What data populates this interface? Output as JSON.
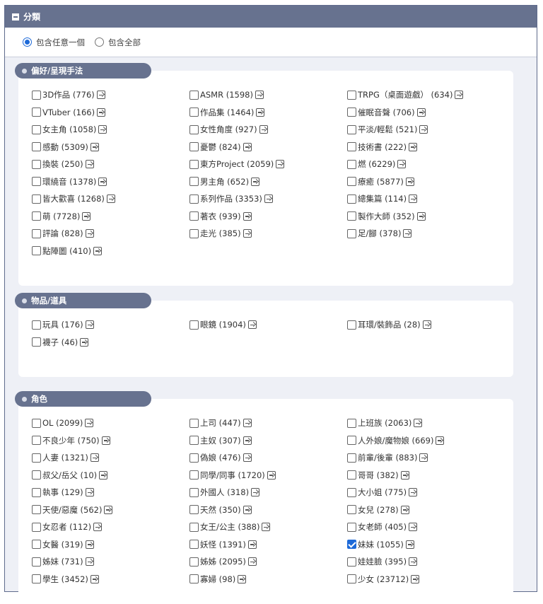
{
  "section": {
    "title": "分類"
  },
  "radios": [
    {
      "label": "包含任意一個",
      "checked": true
    },
    {
      "label": "包含全部",
      "checked": false
    }
  ],
  "groups": [
    {
      "title": "偏好/呈現手法",
      "items": [
        {
          "label": "3D作品 (776)"
        },
        {
          "label": "ASMR (1598)"
        },
        {
          "label": "TRPG（桌面遊戲） (634)"
        },
        {
          "label": "VTuber (166)"
        },
        {
          "label": "作品集 (1464)"
        },
        {
          "label": "催眠音聲 (706)"
        },
        {
          "label": "女主角 (1058)"
        },
        {
          "label": "女性角度 (927)"
        },
        {
          "label": "平淡/輕鬆 (521)"
        },
        {
          "label": "感動 (5309)"
        },
        {
          "label": "憂鬱 (824)"
        },
        {
          "label": "技術書 (222)"
        },
        {
          "label": "換裝 (250)"
        },
        {
          "label": "東方Project (2059)"
        },
        {
          "label": "燃 (6229)"
        },
        {
          "label": "環繞音 (1378)"
        },
        {
          "label": "男主角 (652)"
        },
        {
          "label": "療癒 (5877)"
        },
        {
          "label": "皆大歡喜 (1268)"
        },
        {
          "label": "系列作品 (3353)"
        },
        {
          "label": "總集篇 (114)"
        },
        {
          "label": "萌 (7728)"
        },
        {
          "label": "著衣 (939)"
        },
        {
          "label": "製作大師 (352)"
        },
        {
          "label": "評論 (828)"
        },
        {
          "label": "走光 (385)"
        },
        {
          "label": "足/腳 (378)"
        },
        {
          "label": "點陣圖 (410)"
        }
      ]
    },
    {
      "title": "物品/道具",
      "items": [
        {
          "label": "玩具 (176)"
        },
        {
          "label": "眼鏡 (1904)"
        },
        {
          "label": "耳環/裝飾品 (28)"
        },
        {
          "label": "襪子 (46)"
        }
      ]
    },
    {
      "title": "角色",
      "items": [
        {
          "label": "OL (2099)"
        },
        {
          "label": "上司 (447)"
        },
        {
          "label": "上班族 (2063)"
        },
        {
          "label": "不良少年 (750)"
        },
        {
          "label": "主奴 (307)"
        },
        {
          "label": "人外娘/魔物娘 (669)"
        },
        {
          "label": "人妻 (1321)"
        },
        {
          "label": "偽娘 (476)"
        },
        {
          "label": "前輩/後輩 (883)"
        },
        {
          "label": "叔父/岳父 (10)"
        },
        {
          "label": "同學/同事 (1720)"
        },
        {
          "label": "哥哥 (382)"
        },
        {
          "label": "執事 (129)"
        },
        {
          "label": "外國人 (318)"
        },
        {
          "label": "大小姐 (775)"
        },
        {
          "label": "天使/惡魔 (562)"
        },
        {
          "label": "天然 (350)"
        },
        {
          "label": "女兒 (278)"
        },
        {
          "label": "女忍者 (112)"
        },
        {
          "label": "女王/公主 (388)"
        },
        {
          "label": "女老師 (405)"
        },
        {
          "label": "女醫 (319)"
        },
        {
          "label": "妖怪 (1391)"
        },
        {
          "label": "妹妹 (1055)",
          "checked": true
        },
        {
          "label": "姊妹 (731)"
        },
        {
          "label": "姊姊 (2095)"
        },
        {
          "label": "娃娃臉 (395)"
        },
        {
          "label": "學生 (3452)"
        },
        {
          "label": "寡婦 (98)"
        },
        {
          "label": "少女 (23712)"
        }
      ]
    }
  ]
}
